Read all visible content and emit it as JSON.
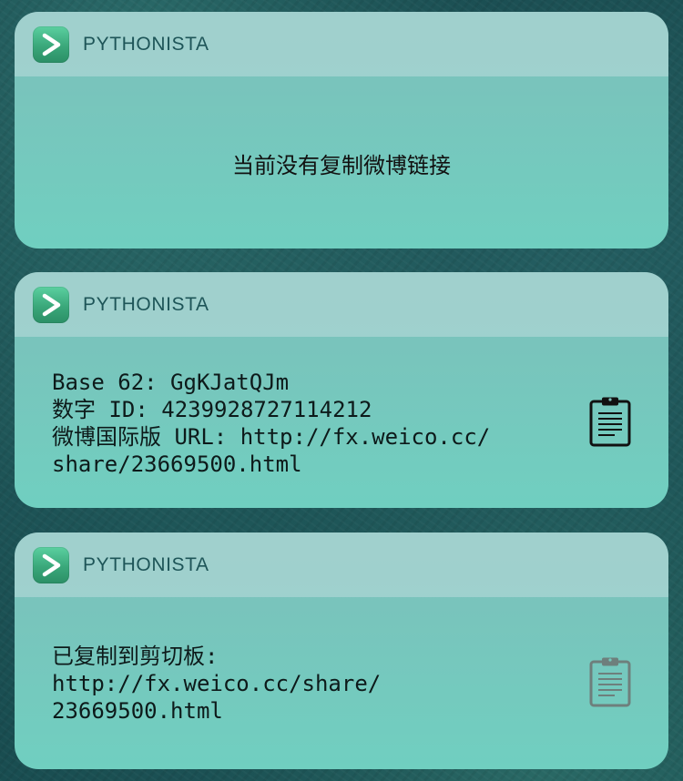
{
  "widgets": [
    {
      "app_name": "PYTHONISTA",
      "message": "当前没有复制微博链接"
    },
    {
      "app_name": "PYTHONISTA",
      "lines": [
        "Base 62: GgKJatQJm",
        "数字 ID: 4239928727114212",
        "微博国际版 URL: http://fx.weico.cc/",
        "share/23669500.html"
      ],
      "action_icon": "clipboard-icon"
    },
    {
      "app_name": "PYTHONISTA",
      "lines": [
        "已复制到剪切板:",
        "http://fx.weico.cc/share/",
        "23669500.html"
      ],
      "action_icon": "clipboard-icon"
    }
  ],
  "colors": {
    "clipboard_active": "#111111",
    "clipboard_inactive": "#6e7f7c",
    "app_icon": "#45b585",
    "app_name_text": "#1e5558"
  }
}
